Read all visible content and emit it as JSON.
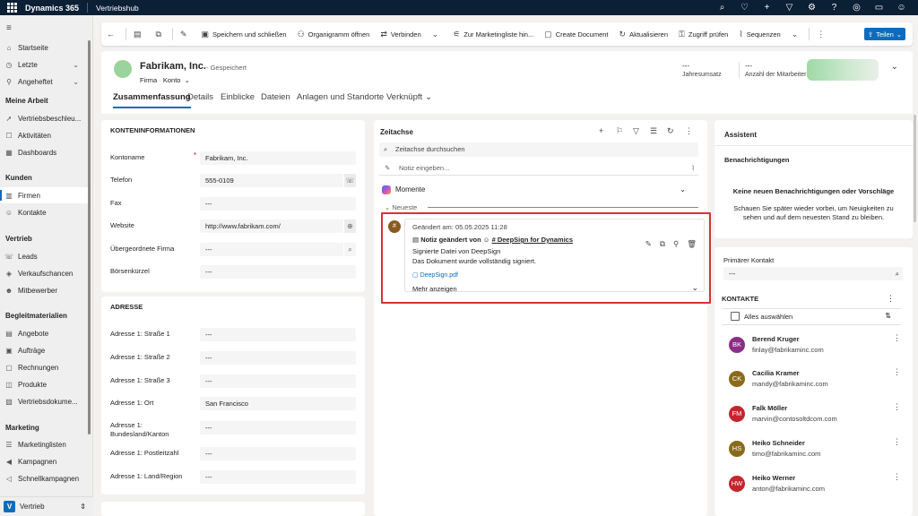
{
  "topbar": {
    "app_name": "Dynamics 365",
    "hub_name": "Vertriebshub",
    "icons": [
      "search-icon",
      "lightbulb-icon",
      "plus-icon",
      "filter-icon",
      "settings-icon",
      "help-icon",
      "copilot-icon",
      "chat-icon",
      "user-icon"
    ]
  },
  "nav": {
    "items_top": [
      {
        "label": "Startseite",
        "icon": "home-icon"
      },
      {
        "label": "Letzte",
        "icon": "clock-icon"
      },
      {
        "label": "Angeheftet",
        "icon": "pin-icon"
      }
    ],
    "sections": [
      {
        "title": "Meine Arbeit",
        "items": [
          "Vertriebsbeschleu...",
          "Aktivitäten",
          "Dashboards"
        ]
      },
      {
        "title": "Kunden",
        "items": [
          "Firmen",
          "Kontakte"
        ]
      },
      {
        "title": "Vertrieb",
        "items": [
          "Leads",
          "Verkaufschancen",
          "Mitbewerber"
        ]
      },
      {
        "title": "Begleitmaterialien",
        "items": [
          "Angebote",
          "Aufträge",
          "Rechnungen",
          "Produkte",
          "Vertriebsdokume..."
        ]
      },
      {
        "title": "Marketing",
        "items": [
          "Marketinglisten",
          "Kampagnen",
          "Schnellkampagnen"
        ]
      }
    ],
    "area": {
      "badge": "V",
      "label": "Vertrieb"
    }
  },
  "commandbar": {
    "items": [
      "Speichern und schließen",
      "Organigramm öffnen",
      "Verbinden",
      "Zur Marketingliste hin...",
      "Create Document",
      "Aktualisieren",
      "Zugriff prüfen",
      "Sequenzen"
    ],
    "share": "Teilen"
  },
  "header": {
    "title": "Fabrikam, Inc.",
    "saved": "- Gespeichert",
    "entity": "Firma",
    "form": "Konto",
    "fields": [
      {
        "value": "---",
        "label": "Jahresumsatz"
      },
      {
        "value": "---",
        "label": "Anzahl der Mitarbeiter"
      }
    ],
    "tabs": [
      "Zusammenfassung",
      "Details",
      "Einblicke",
      "Dateien",
      "Anlagen und Standorte",
      "Verknüpft"
    ]
  },
  "account_info": {
    "title": "KONTENINFORMATIONEN",
    "fields": [
      {
        "label": "Kontoname",
        "value": "Fabrikam, Inc."
      },
      {
        "label": "Telefon",
        "value": "555-0109"
      },
      {
        "label": "Fax",
        "value": "---"
      },
      {
        "label": "Website",
        "value": "http://www.fabrikam.com/"
      },
      {
        "label": "Übergeordnete Firma",
        "value": "---"
      },
      {
        "label": "Börsenkürzel",
        "value": "---"
      }
    ]
  },
  "address": {
    "title": "ADRESSE",
    "fields": [
      {
        "label": "Adresse 1: Straße 1",
        "value": "---"
      },
      {
        "label": "Adresse 1: Straße 2",
        "value": "---"
      },
      {
        "label": "Adresse 1: Straße 3",
        "value": "---"
      },
      {
        "label": "Adresse 1: Ort",
        "value": "San Francisco"
      },
      {
        "label": "Adresse 1: Bundesland/Kanton",
        "value": "---"
      },
      {
        "label": "Adresse 1: Postleitzahl",
        "value": "---"
      },
      {
        "label": "Adresse 1: Land/Region",
        "value": "---"
      }
    ]
  },
  "timeline": {
    "title": "Zeitachse",
    "search_placeholder": "Zeitachse durchsuchen",
    "note_placeholder": "Notiz eingeben...",
    "moments": "Momente",
    "newest": "Neueste",
    "entry": {
      "badge": "#",
      "modified": "Geändert am: 05.05.2025 11:28",
      "note_changed_by": "Notiz geändert von",
      "author": "# DeepSign for Dynamics",
      "line1": "Signierte Datei von DeepSign",
      "line2": "Das Dokument wurde vollständig signiert.",
      "attachment": "DeepSign.pdf",
      "show_more": "Mehr anzeigen"
    }
  },
  "assistant": {
    "title": "Assistent",
    "notifications": "Benachrichtigungen",
    "empty_title": "Keine neuen Benachrichtigungen oder Vorschläge",
    "empty_text": "Schauen Sie später wieder vorbei, um Neuigkeiten zu sehen und auf dem neuesten Stand zu bleiben."
  },
  "primary_contact": {
    "label": "Primärer Kontakt",
    "value": "---",
    "contacts_title": "KONTAKTE",
    "select_all": "Alles auswählen",
    "contacts": [
      {
        "initials": "BK",
        "name": "Berend Kruger",
        "email": "finlay@fabrikaminc.com",
        "color": "#8c2d86"
      },
      {
        "initials": "CK",
        "name": "Cacilia Kramer",
        "email": "mandy@fabrikaminc.com",
        "color": "#8b6a1a"
      },
      {
        "initials": "FM",
        "name": "Falk Möller",
        "email": "marvin@contosoltdcom.com",
        "color": "#c4262e"
      },
      {
        "initials": "HS",
        "name": "Heiko Schneider",
        "email": "timo@fabrikaminc.com",
        "color": "#8b6a1a"
      },
      {
        "initials": "HW",
        "name": "Heiko Werner",
        "email": "anton@fabrikaminc.com",
        "color": "#c4262e"
      }
    ]
  }
}
